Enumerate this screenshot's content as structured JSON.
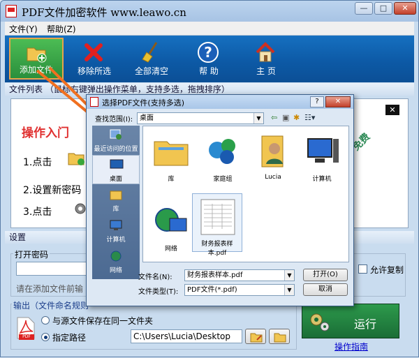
{
  "window": {
    "title": "PDF文件加密软件 www.leawo.cn",
    "controls": {
      "minimize": "—",
      "maximize": "□",
      "close": "✕"
    }
  },
  "menu": {
    "file": "文件(Y)",
    "help": "帮助(Z)"
  },
  "toolbar": {
    "add_file": "添加文件",
    "remove_selected": "移除所选",
    "clear_all": "全部清空",
    "help": "帮 助",
    "home": "主 页"
  },
  "file_list": {
    "header": "文件列表 （鼠标右键弹出操作菜单，支持多选，拖拽排序）",
    "close": "✕",
    "guide_title": "操作入门",
    "step1": "1.点击",
    "step2": "2.设置新密码",
    "step3": "3.点击",
    "free_badge": "免费"
  },
  "settings": {
    "header": "设置",
    "open_password_label": "打开密码",
    "open_password_value": "",
    "hint": "请在添加文件前输",
    "allow_copy_label": "允许复制",
    "allow_copy_checked": false
  },
  "output": {
    "group_label": "输出（文件命名规则",
    "same_folder_label": "与源文件保存在同一文件夹",
    "custom_path_label": "指定路径",
    "path_value": "C:\\Users\\Lucia\\Desktop",
    "pdf_badge": "PDF",
    "run_label": "运行",
    "guide_link": "操作指南"
  },
  "dialog": {
    "title": "选择PDF文件(支持多选)",
    "help_btn": "?",
    "close_btn": "✕",
    "look_in_label": "查找范围(I):",
    "look_in_value": "桌面",
    "places": [
      "最近访问的位置",
      "桌面",
      "库",
      "计算机",
      "网络"
    ],
    "files": [
      {
        "name": "库"
      },
      {
        "name": "家庭组"
      },
      {
        "name": "Lucia"
      },
      {
        "name": "计算机"
      },
      {
        "name": "网络"
      },
      {
        "name": "财务报表样本.pdf"
      }
    ],
    "filename_label": "文件名(N):",
    "filename_value": "财务报表样本.pdf",
    "filetype_label": "文件类型(T):",
    "filetype_value": "PDF文件(*.pdf)",
    "open_btn": "打开(O)",
    "cancel_btn": "取消"
  }
}
